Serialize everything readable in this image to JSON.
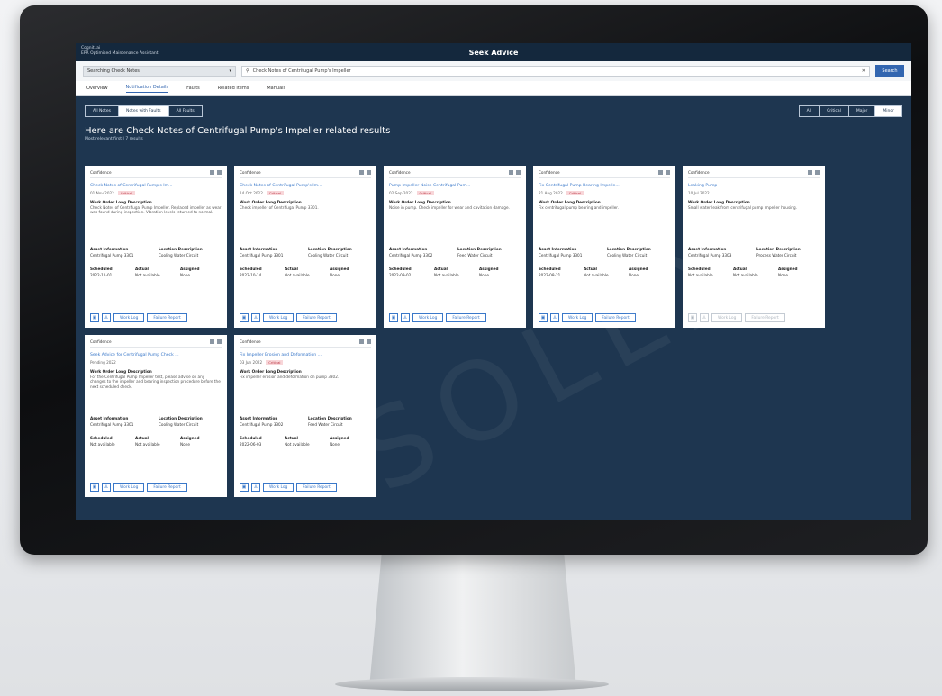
{
  "app": {
    "corner_title_line1": "Cogniti.ai",
    "corner_title_line2": "EPR Optimised Maintenance Assistant",
    "center_title": "Seek Advice"
  },
  "search": {
    "dropdown_value": "Searching Check Notes",
    "query": "Check Notes of Centrifugal Pump's Impeller",
    "button_label": "Search"
  },
  "nav_tabs": [
    "Overview",
    "Notification Details",
    "Faults",
    "Related Items",
    "Manuals"
  ],
  "view_toggle": [
    "All Notes",
    "Notes with Faults",
    "All Faults"
  ],
  "filter_toggle": [
    "All",
    "Critical",
    "Major",
    "Minor"
  ],
  "results": {
    "headline": "Here are Check Notes of Centrifugal Pump's Impeller related results",
    "subline": "Most relevant first | 7 results"
  },
  "cards": [
    {
      "confidence": "Confidence",
      "title": "Check Notes of Centrifugal Pump's Im...",
      "date": "01 Nov 2022",
      "tag": "Critical",
      "desc_label": "Work Order Long Description",
      "description": "Check Notes of Centrifugal Pump Impeller. Replaced impeller as wear was found during inspection. Vibration levels returned to normal.",
      "asset_label": "Asset Information",
      "asset_value": "Centrifugal Pump 3301",
      "location_label": "Location Description",
      "location_value": "Cooling Water Circuit",
      "scheduled_label": "Scheduled",
      "scheduled_value": "2022-11-01",
      "actual_label": "Actual",
      "actual_value": "Not available",
      "assigned_label": "Assigned",
      "assigned_value": "None",
      "work_log": "Work Log",
      "failure_report": "Failure Report",
      "enabled": true
    },
    {
      "confidence": "Confidence",
      "title": "Check Notes of Centrifugal Pump's Im...",
      "date": "14 Oct 2022",
      "tag": "Critical",
      "desc_label": "Work Order Long Description",
      "description": "Check impeller of Centrifugal Pump 3301.",
      "asset_label": "Asset Information",
      "asset_value": "Centrifugal Pump 3301",
      "location_label": "Location Description",
      "location_value": "Cooling Water Circuit",
      "scheduled_label": "Scheduled",
      "scheduled_value": "2022-10-14",
      "actual_label": "Actual",
      "actual_value": "Not available",
      "assigned_label": "Assigned",
      "assigned_value": "None",
      "work_log": "Work Log",
      "failure_report": "Failure Report",
      "enabled": true
    },
    {
      "confidence": "Confidence",
      "title": "Pump Impeller Noise Centrifugal Pum...",
      "date": "02 Sep 2022",
      "tag": "Critical",
      "desc_label": "Work Order Long Description",
      "description": "Noise in pump. Check impeller for wear and cavitation damage.",
      "asset_label": "Asset Information",
      "asset_value": "Centrifugal Pump 3302",
      "location_label": "Location Description",
      "location_value": "Feed Water Circuit",
      "scheduled_label": "Scheduled",
      "scheduled_value": "2022-09-02",
      "actual_label": "Actual",
      "actual_value": "Not available",
      "assigned_label": "Assigned",
      "assigned_value": "None",
      "work_log": "Work Log",
      "failure_report": "Failure Report",
      "enabled": true
    },
    {
      "confidence": "Confidence",
      "title": "Fix Centrifugal Pump Bearing Impelle...",
      "date": "21 Aug 2022",
      "tag": "Critical",
      "desc_label": "Work Order Long Description",
      "description": "Fix centrifugal pump bearing and impeller.",
      "asset_label": "Asset Information",
      "asset_value": "Centrifugal Pump 3301",
      "location_label": "Location Description",
      "location_value": "Cooling Water Circuit",
      "scheduled_label": "Scheduled",
      "scheduled_value": "2022-08-21",
      "actual_label": "Actual",
      "actual_value": "Not available",
      "assigned_label": "Assigned",
      "assigned_value": "None",
      "work_log": "Work Log",
      "failure_report": "Failure Report",
      "enabled": true
    },
    {
      "confidence": "Confidence",
      "title": "Leaking Pump",
      "date": "10 Jul 2022",
      "tag": "",
      "desc_label": "Work Order Long Description",
      "description": "Small water leak from centrifugal pump impeller housing.",
      "asset_label": "Asset Information",
      "asset_value": "Centrifugal Pump 3303",
      "location_label": "Location Description",
      "location_value": "Process Water Circuit",
      "scheduled_label": "Scheduled",
      "scheduled_value": "Not available",
      "actual_label": "Actual",
      "actual_value": "Not available",
      "assigned_label": "Assigned",
      "assigned_value": "None",
      "work_log": "Work Log",
      "failure_report": "Failure Report",
      "enabled": false
    },
    {
      "confidence": "Confidence",
      "title": "Seek Advice for Centrifugal Pump Check ...",
      "date": "Pending 2022",
      "tag": "",
      "desc_label": "Work Order Long Description",
      "description": "For the Centrifugal Pump Impeller test, please advise on any changes to the impeller and bearing inspection procedure before the next scheduled check.",
      "asset_label": "Asset Information",
      "asset_value": "Centrifugal Pump 3301",
      "location_label": "Location Description",
      "location_value": "Cooling Water Circuit",
      "scheduled_label": "Scheduled",
      "scheduled_value": "Not available",
      "actual_label": "Actual",
      "actual_value": "Not available",
      "assigned_label": "Assigned",
      "assigned_value": "None",
      "work_log": "Work Log",
      "failure_report": "Failure Report",
      "enabled": true
    },
    {
      "confidence": "Confidence",
      "title": "Fix Impeller Erosion and Deformation ...",
      "date": "03 Jun 2022",
      "tag": "Critical",
      "desc_label": "Work Order Long Description",
      "description": "Fix impeller erosion and deformation on pump 3302.",
      "asset_label": "Asset Information",
      "asset_value": "Centrifugal Pump 3302",
      "location_label": "Location Description",
      "location_value": "Feed Water Circuit",
      "scheduled_label": "Scheduled",
      "scheduled_value": "2022-06-03",
      "actual_label": "Actual",
      "actual_value": "Not available",
      "assigned_label": "Assigned",
      "assigned_value": "None",
      "work_log": "Work Log",
      "failure_report": "Failure Report",
      "enabled": true
    }
  ],
  "watermark": "SOLEX",
  "colors": {
    "screen_bg": "#1e3650",
    "accent": "#3366b0",
    "critical_tag": "#f8d6d9"
  }
}
